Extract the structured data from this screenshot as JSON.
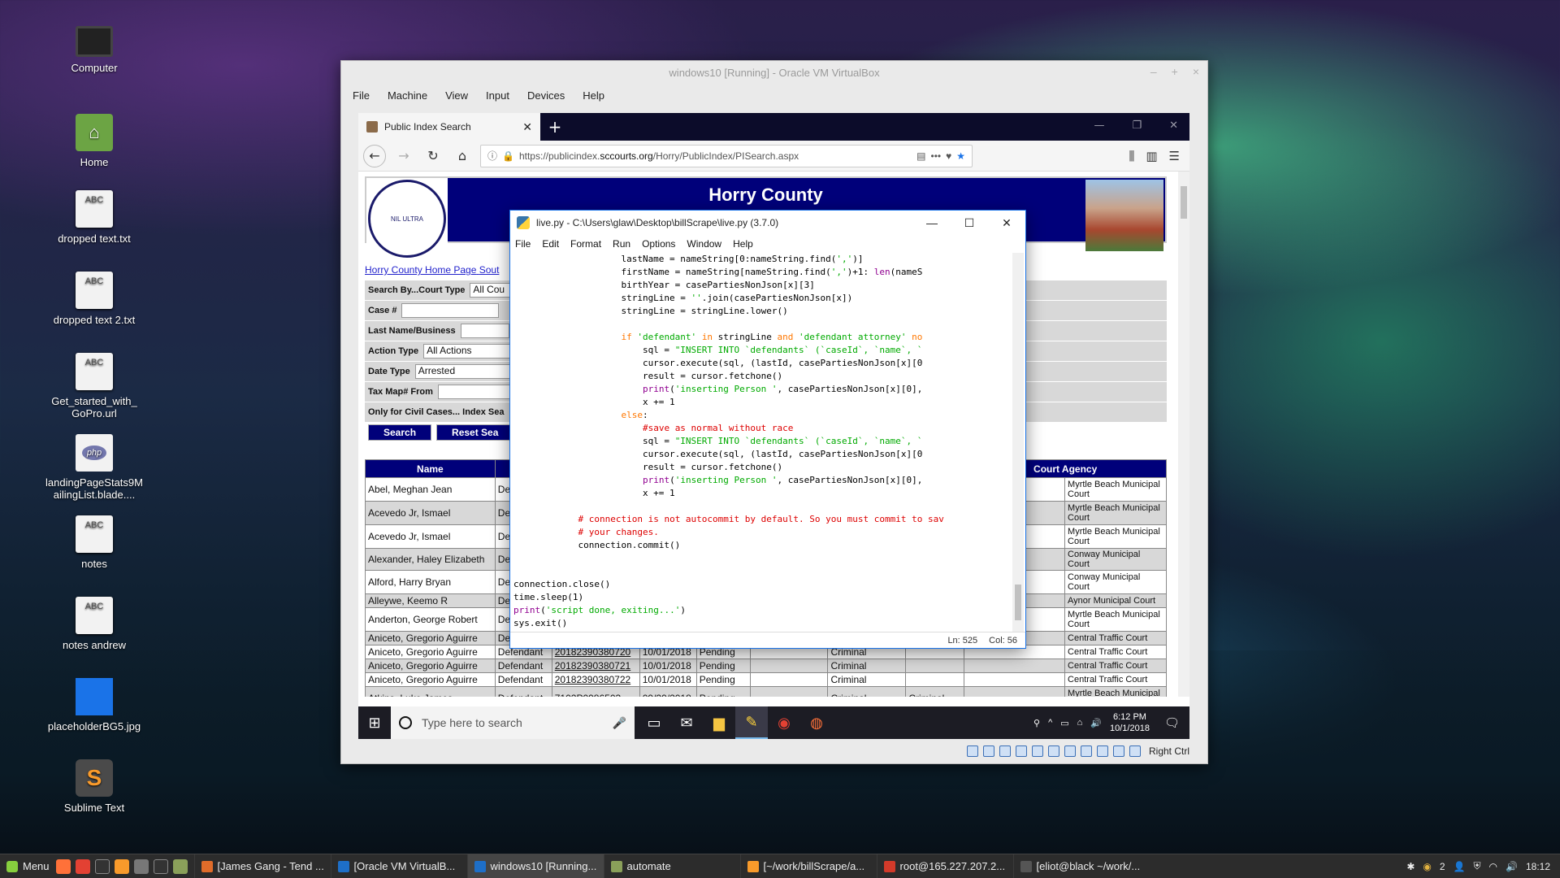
{
  "desktop": {
    "icons": [
      {
        "label": "Computer",
        "icon": "computer-icon"
      },
      {
        "label": "Home",
        "icon": "home-folder-icon"
      },
      {
        "label": "dropped text.txt",
        "icon": "text-file-icon"
      },
      {
        "label": "dropped text 2.txt",
        "icon": "text-file-icon"
      },
      {
        "label": "Get_started_with_GoPro.url",
        "icon": "text-file-icon"
      },
      {
        "label": "landingPageStats9MailingList.blade....",
        "icon": "php-file-icon"
      },
      {
        "label": "notes",
        "icon": "text-file-icon"
      },
      {
        "label": "notes andrew",
        "icon": "text-file-icon"
      },
      {
        "label": "placeholderBG5.jpg",
        "icon": "image-file-icon"
      },
      {
        "label": "Sublime Text",
        "icon": "sublime-icon"
      }
    ],
    "file_glyph_text": "ABC",
    "php_glyph_text": "php"
  },
  "vbox": {
    "title": "windows10 [Running] - Oracle VM VirtualBox",
    "menu": [
      "File",
      "Machine",
      "View",
      "Input",
      "Devices",
      "Help"
    ],
    "host_key": "Right Ctrl"
  },
  "firefox": {
    "tab_title": "Public Index Search",
    "url_prefix": "https://publicindex.",
    "url_host": "sccourts.org",
    "url_path": "/Horry/PublicIndex/PISearch.aspx"
  },
  "site": {
    "title": "Horry County",
    "seal_text": "NIL ULTRA",
    "links": "Horry County Home Page",
    "links_partial": "Sout",
    "form": {
      "court_type_label": "Search By...Court Type",
      "court_type_value": "All Cou",
      "case_label": "Case #",
      "name_label": "Last Name/Business",
      "action_label": "Action Type",
      "action_value": "All Actions",
      "date_label": "Date Type",
      "date_value": "Arrested",
      "tax_label": "Tax Map# From",
      "civil_label": "Only for Civil Cases... Index Sea",
      "search_btn": "Search",
      "reset_btn": "Reset Sea"
    },
    "table": {
      "headers": [
        "Name",
        "",
        "",
        "",
        "",
        "",
        "",
        "ent",
        "Court Agency"
      ],
      "rows": [
        {
          "name": "Abel, Meghan Jean",
          "role": "De",
          "case": "",
          "date": "",
          "status": "",
          "type": "",
          "sub": "",
          "agency": "Myrtle Beach Municipal Court",
          "tall": true
        },
        {
          "name": "Acevedo Jr, Ismael",
          "role": "De",
          "case": "",
          "date": "",
          "status": "",
          "type": "",
          "sub": "",
          "agency": "Myrtle Beach Municipal Court",
          "tall": true
        },
        {
          "name": "Acevedo Jr, Ismael",
          "role": "De",
          "case": "",
          "date": "",
          "status": "",
          "type": "",
          "sub": "",
          "agency": "Myrtle Beach Municipal Court",
          "tall": true
        },
        {
          "name": "Alexander, Haley Elizabeth",
          "role": "De",
          "case": "",
          "date": "",
          "status": "",
          "type": "",
          "sub": "",
          "agency": "Conway Municipal Court",
          "tall": false
        },
        {
          "name": "Alford, Harry Bryan",
          "role": "De",
          "case": "",
          "date": "",
          "status": "",
          "type": "",
          "sub": "",
          "agency": "Conway Municipal Court",
          "tall": true
        },
        {
          "name": "Alleywe, Keemo R",
          "role": "De",
          "case": "",
          "date": "",
          "status": "",
          "type": "",
          "sub": "",
          "agency": "Aynor Municipal Court",
          "tall": false
        },
        {
          "name": "Anderton, George Robert",
          "role": "De",
          "case": "",
          "date": "",
          "status": "",
          "type": "",
          "sub": "",
          "agency": "Myrtle Beach Municipal Court",
          "tall": true
        },
        {
          "name": "Aniceto, Gregorio Aguirre",
          "role": "De",
          "case": "",
          "date": "",
          "status": "",
          "type": "",
          "sub": "",
          "agency": "Central Traffic Court",
          "tall": false
        },
        {
          "name": "Aniceto, Gregorio Aguirre",
          "role": "Defendant",
          "case": "20182390380720",
          "date": "10/01/2018",
          "status": "Pending",
          "type": "Criminal",
          "sub": "",
          "agency": "Central Traffic Court",
          "tall": false
        },
        {
          "name": "Aniceto, Gregorio Aguirre",
          "role": "Defendant",
          "case": "20182390380721",
          "date": "10/01/2018",
          "status": "Pending",
          "type": "Criminal",
          "sub": "",
          "agency": "Central Traffic Court",
          "tall": false
        },
        {
          "name": "Aniceto, Gregorio Aguirre",
          "role": "Defendant",
          "case": "20182390380722",
          "date": "10/01/2018",
          "status": "Pending",
          "type": "Criminal",
          "sub": "",
          "agency": "Central Traffic Court",
          "tall": false
        },
        {
          "name": "Atkins, Luke James",
          "role": "Defendant",
          "case": "7102P0986503",
          "date": "09/29/2018",
          "status": "Pending",
          "type": "Criminal",
          "sub": "Criminal",
          "agency": "Myrtle Beach Municipal Court",
          "tall": true
        }
      ]
    }
  },
  "win_taskbar": {
    "search_placeholder": "Type here to search",
    "time": "6:12 PM",
    "date": "10/1/2018"
  },
  "idle": {
    "title": "live.py - C:\\Users\\glaw\\Desktop\\billScrape\\live.py (3.7.0)",
    "menu": [
      "File",
      "Edit",
      "Format",
      "Run",
      "Options",
      "Window",
      "Help"
    ],
    "status_ln": "Ln: 525",
    "status_col": "Col: 56"
  },
  "panel": {
    "menu_label": "Menu",
    "tasks": [
      {
        "label": "[James Gang - Tend ...",
        "color": "#e06c2a",
        "active": false
      },
      {
        "label": "[Oracle VM VirtualB...",
        "color": "#1e6fc8",
        "active": false
      },
      {
        "label": "windows10 [Running...",
        "color": "#1e6fc8",
        "active": true
      },
      {
        "label": "automate",
        "color": "#8aa05a",
        "active": false
      },
      {
        "label": "[~/work/billScrape/a...",
        "color": "#f89a2b",
        "active": false
      },
      {
        "label": "root@165.227.207.2...",
        "color": "#d23a2a",
        "active": false
      },
      {
        "label": "[eliot@black ~/work/...",
        "color": "#555555",
        "active": false
      }
    ],
    "tray_count": "2",
    "clock": "18:12"
  }
}
